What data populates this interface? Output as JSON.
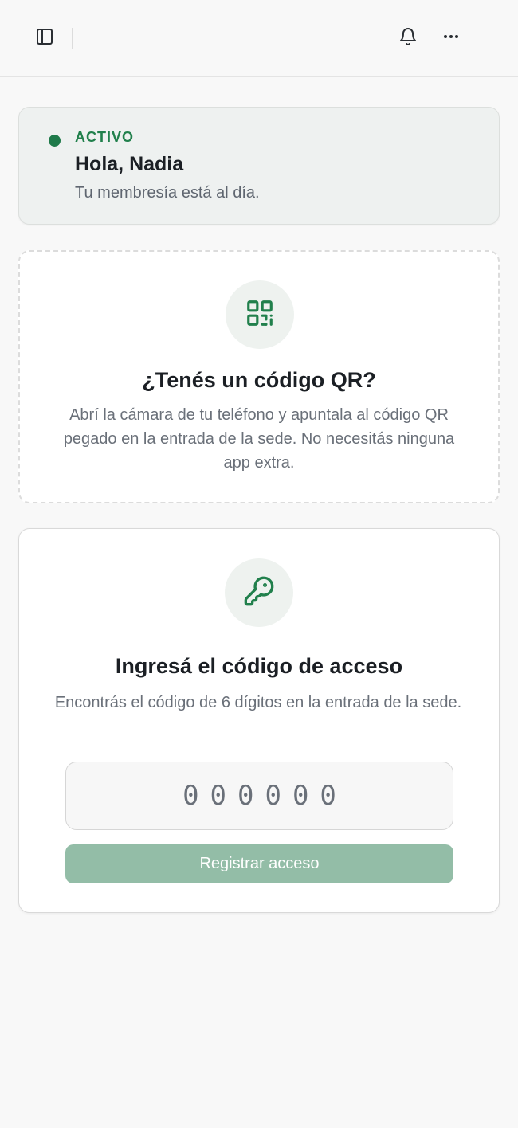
{
  "topbar": {
    "sidebar_toggle_icon": "sidebar-icon",
    "notifications_icon": "bell-icon",
    "more_icon": "more-horizontal-icon"
  },
  "status": {
    "label": "ACTIVO",
    "greeting": "Hola, Nadia",
    "message": "Tu membresía está al día.",
    "color": "#1f7a4a"
  },
  "qr": {
    "icon": "qr-code-icon",
    "title": "¿Tenés un código QR?",
    "description": "Abrí la cámara de tu teléfono y apuntala al código QR pegado en la entrada de la sede. No necesitás ninguna app extra."
  },
  "access_code": {
    "icon": "key-icon",
    "title": "Ingresá el código de acceso",
    "description": "Encontrás el código de 6 dígitos en la entrada de la sede.",
    "input_placeholder": "000000",
    "input_value": "",
    "submit_label": "Registrar acceso",
    "submit_color": "#93bda7"
  },
  "colors": {
    "accent": "#21804c",
    "background": "#f8f8f8"
  }
}
